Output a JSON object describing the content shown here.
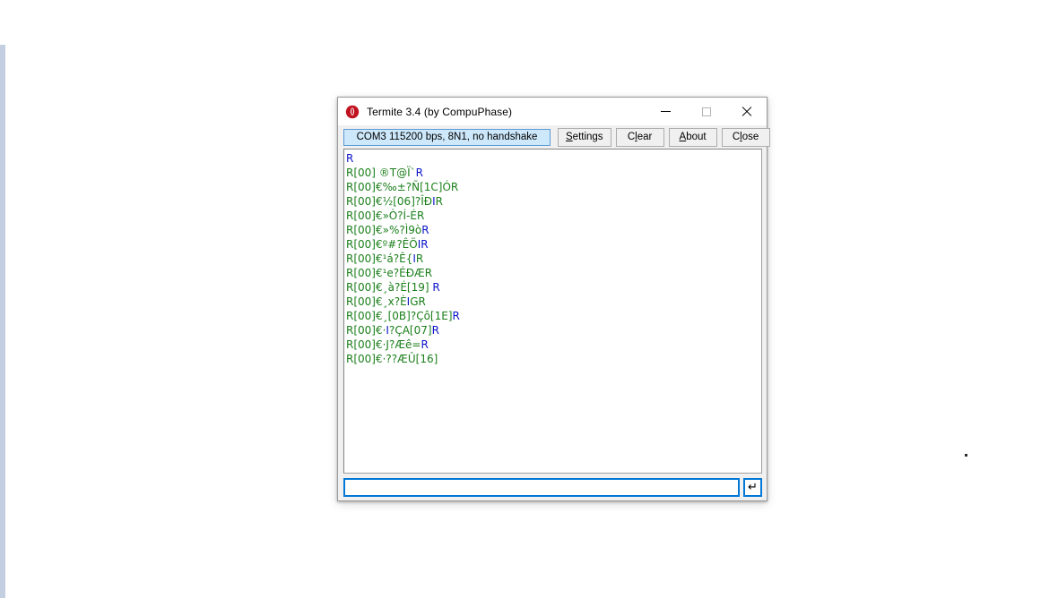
{
  "window": {
    "title": "Termite 3.4 (by CompuPhase)",
    "icon": "termite-logo-icon",
    "controls": {
      "minimize": "minimize-icon",
      "maximize": "maximize-icon",
      "close": "close-icon"
    }
  },
  "toolbar": {
    "port_status": "COM3 115200 bps, 8N1, no handshake",
    "settings_label_pre": "",
    "settings_accel": "S",
    "settings_label_post": "ettings",
    "clear_label_pre": "C",
    "clear_accel": "l",
    "clear_label_post": "ear",
    "about_label_pre": "",
    "about_accel": "A",
    "about_label_post": "bout",
    "close_label_pre": "C",
    "close_accel": "l",
    "close_label_post": "ose"
  },
  "terminal": {
    "lines": [
      [
        {
          "t": "R",
          "c": "blue"
        }
      ],
      [
        {
          "t": "R[00] ®T@Ï`",
          "c": "green"
        },
        {
          "t": "R",
          "c": "blue"
        }
      ],
      [
        {
          "t": "R[00]€‰±?Ñ[1C]ÓR",
          "c": "green"
        }
      ],
      [
        {
          "t": "R[00]€½[06]?ÎÐ",
          "c": "green"
        },
        {
          "t": "I",
          "c": "blue"
        },
        {
          "t": "R",
          "c": "green"
        }
      ],
      [
        {
          "t": "R[00]€»Ò?Í-ÉR",
          "c": "green"
        }
      ],
      [
        {
          "t": "R[00]€»%?Ì9ò",
          "c": "green"
        },
        {
          "t": "R",
          "c": "blue"
        }
      ],
      [
        {
          "t": "R[00]€º#?ÊÖ",
          "c": "green"
        },
        {
          "t": "I",
          "c": "blue"
        },
        {
          "t": "R",
          "c": "blue"
        }
      ],
      [
        {
          "t": "R[00]€¹á?Ê{",
          "c": "green"
        },
        {
          "t": "I",
          "c": "blue"
        },
        {
          "t": "R",
          "c": "green"
        }
      ],
      [
        {
          "t": "R[00]€¹e?ÉÐÆR",
          "c": "green"
        }
      ],
      [
        {
          "t": "R[00]€¸à?É[19] ",
          "c": "green"
        },
        {
          "t": "R",
          "c": "blue"
        }
      ],
      [
        {
          "t": "R[00]€¸x?È",
          "c": "green"
        },
        {
          "t": "I",
          "c": "blue"
        },
        {
          "t": "GR",
          "c": "green"
        }
      ],
      [
        {
          "t": "R[00]€¸[0B]?Çô[1E]",
          "c": "green"
        },
        {
          "t": "R",
          "c": "blue"
        }
      ],
      [
        {
          "t": "R[00]€·",
          "c": "green"
        },
        {
          "t": "I",
          "c": "blue"
        },
        {
          "t": "?ÇA[07]",
          "c": "green"
        },
        {
          "t": "R",
          "c": "blue"
        }
      ],
      [
        {
          "t": "R[00]€·J?Æê=",
          "c": "green"
        },
        {
          "t": "R",
          "c": "blue"
        }
      ],
      [
        {
          "t": "R[00]€·??ÆÛ[16]",
          "c": "green"
        }
      ]
    ]
  },
  "input": {
    "value": "",
    "placeholder": "",
    "send_icon": "↵"
  },
  "colors": {
    "accent": "#0078d7",
    "status_bg": "#cde8fb",
    "status_border": "#5b9bd5",
    "text_green": "#1b7f1b",
    "text_blue": "#0b14c8",
    "window_bg": "#f0f0f0",
    "desktop_strip": "#c3cfe0"
  }
}
